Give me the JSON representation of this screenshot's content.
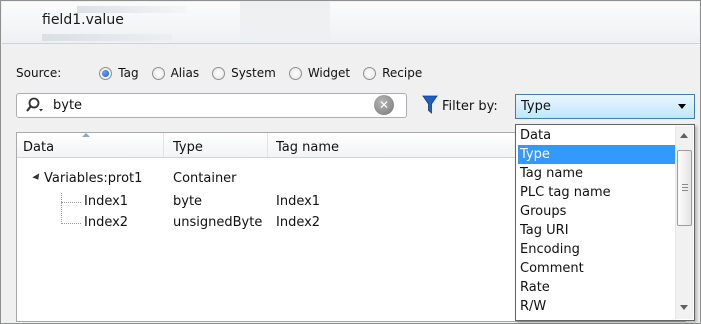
{
  "window": {
    "title": "field1.value"
  },
  "source": {
    "label": "Source:",
    "options": [
      "Tag",
      "Alias",
      "System",
      "Widget",
      "Recipe"
    ],
    "selected": "Tag"
  },
  "search": {
    "value": "byte",
    "icon": "search-icon"
  },
  "filter": {
    "label": "Filter by:",
    "value": "Type",
    "options": [
      "Data",
      "Type",
      "Tag name",
      "PLC tag name",
      "Groups",
      "Tag URI",
      "Encoding",
      "Comment",
      "Rate",
      "R/W"
    ],
    "selected_index": 1
  },
  "table": {
    "columns": [
      "Data",
      "Type",
      "Tag name"
    ],
    "rows": [
      {
        "data": "Variables:prot1",
        "type": "Container",
        "tag": ""
      },
      {
        "data": "Index1",
        "type": "byte",
        "tag": "Index1"
      },
      {
        "data": "Index2",
        "type": "unsignedByte",
        "tag": "Index2"
      }
    ]
  },
  "colors": {
    "selection": "#3399ff",
    "filter_icon": "#1c5fbf"
  }
}
